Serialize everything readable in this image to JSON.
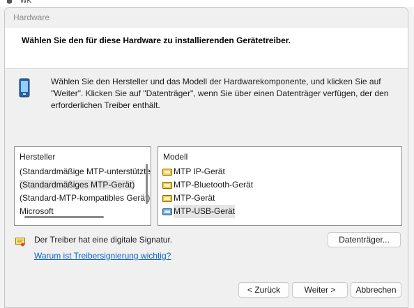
{
  "background": {
    "window_text": "WK"
  },
  "dialog": {
    "title": "Hardware",
    "header": "Wählen Sie den für diese Hardware zu installierenden Gerätetreiber.",
    "info_lines": [
      "Wählen Sie den Hersteller und das Modell der Hardwarekomponente, und klicken Sie auf",
      "\"Weiter\". Klicken Sie auf \"Datenträger\", wenn Sie über einen Datenträger verfügen, der den",
      "erforderlichen Treiber enthält."
    ],
    "manufacturer": {
      "header": "Hersteller",
      "items": [
        "(Standardmäßige MTP-unterstützte Geräte)",
        "(Standardmäßiges MTP-Gerät)",
        "(Standard-MTP-kompatibles Gerät)",
        "Microsoft"
      ],
      "selected": "(Standardmäßiges MTP-Gerät)"
    },
    "model": {
      "header": "Modell",
      "items": [
        "MTP IP-Gerät",
        "MTP-Bluetooth-Gerät",
        "MTP-Gerät",
        "MTP-USB-Gerät"
      ],
      "selected": "MTP-USB-Gerät"
    },
    "signature_text": "Der Treiber hat eine digitale Signatur.",
    "signature_link": "Warum ist Treibersignierung wichtig?",
    "buttons": {
      "disk": "Datenträger...",
      "back": "< Zurück",
      "next": "Weiter >",
      "cancel": "Abbrechen"
    }
  },
  "colors": {
    "link": "#0b63c2",
    "selection": "#e5e5e5",
    "header_bg": "#ffffff",
    "dialog_bg": "#f0f0f0"
  }
}
